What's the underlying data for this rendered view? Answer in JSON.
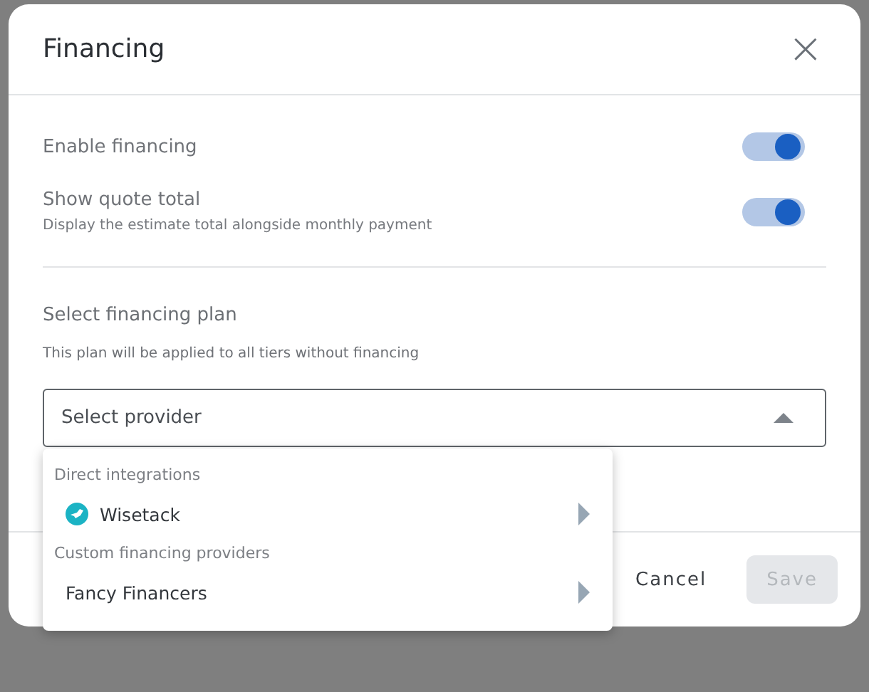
{
  "dialog": {
    "title": "Financing",
    "close": "×"
  },
  "toggles": [
    {
      "label": "Enable financing",
      "on": true
    },
    {
      "label": "Show quote total",
      "description": "Display the estimate total alongside monthly payment",
      "on": true
    }
  ],
  "plan": {
    "heading": "Select financing plan",
    "hint": "This plan will be applied to all tiers without financing",
    "select": {
      "placeholder": "Select provider",
      "expanded": true
    }
  },
  "menu": {
    "groups": [
      {
        "heading": "Direct integrations",
        "items": [
          {
            "label": "Wisetack",
            "kind": "logo"
          }
        ]
      },
      {
        "heading": "Custom financing providers",
        "items": [
          {
            "label": "Fancy Financers",
            "kind": "plain"
          }
        ]
      }
    ]
  },
  "buttons": [
    {
      "label": "Cancel",
      "kind": "text",
      "disabled": false
    },
    {
      "label": "Save",
      "kind": "filled",
      "disabled": true
    }
  ]
}
